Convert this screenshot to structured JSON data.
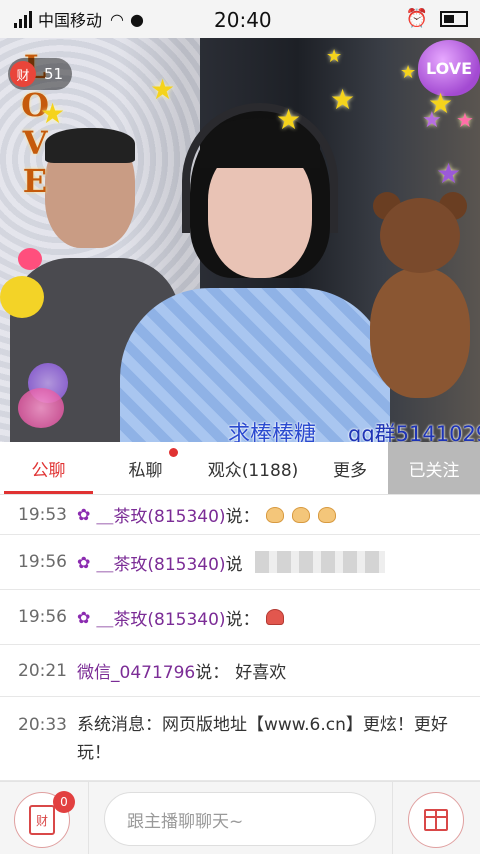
{
  "status_bar": {
    "carrier": "中国移动",
    "time": "20:40",
    "icons": [
      "signal-icon",
      "wifi-icon",
      "wechat-icon",
      "alarm-icon",
      "battery-icon"
    ]
  },
  "video": {
    "wealth_badge": {
      "icon_label": "财",
      "count": "51"
    },
    "overlay_love_text": [
      "L",
      "O",
      "V",
      "E"
    ],
    "heart_badge_text": "LOVE",
    "caption": "求棒棒糖",
    "caption_qq": "qq群5141029"
  },
  "tabs": [
    {
      "label": "公聊",
      "active": true
    },
    {
      "label": "私聊",
      "has_dot": true
    },
    {
      "label": "观众(1188)"
    },
    {
      "label": "更多"
    },
    {
      "label": "已关注"
    }
  ],
  "chat": {
    "messages": [
      {
        "time": "19:53",
        "user": "＿茶玫(815340)",
        "say": "说：",
        "content": "clap-emoji x3"
      },
      {
        "time": "19:56",
        "user": "＿茶玫(815340)",
        "say": "说",
        "content": "blurred"
      },
      {
        "time": "19:56",
        "user": "＿茶玫(815340)",
        "say": "说：",
        "content": "octopus-emoji"
      },
      {
        "time": "20:21",
        "user": "微信_0471796",
        "say": "说：",
        "content": "好喜欢"
      },
      {
        "time": "20:33",
        "system_text": "系统消息：网页版地址【www.6.cn】更炫！更好玩！"
      }
    ]
  },
  "bottom": {
    "wallet_label": "财",
    "wallet_badge": "0",
    "input_placeholder": "跟主播聊聊天~"
  },
  "colors": {
    "accent": "#e03232",
    "username": "#7b2c96",
    "follow_bg": "#b9b9b9"
  }
}
